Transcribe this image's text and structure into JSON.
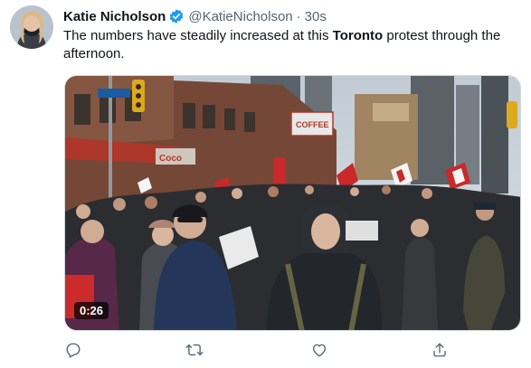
{
  "tweet": {
    "author_name": "Katie Nicholson",
    "handle": "@KatieNicholson",
    "separator": "·",
    "time": "30s",
    "text_before": "The numbers have steadily increased at this ",
    "text_bold": "Toronto",
    "text_after": " protest through the afternoon."
  },
  "media": {
    "duration": "0:26",
    "sign_coco": "Coco",
    "sign_coffee": "COFFEE"
  },
  "icons": {
    "verified": "verified-badge-icon",
    "reply": "reply-icon",
    "retweet": "retweet-icon",
    "like": "like-icon",
    "share": "share-icon"
  },
  "colors": {
    "verified": "#1d9bf0",
    "action_gray": "#536471",
    "text": "#0f1419"
  }
}
